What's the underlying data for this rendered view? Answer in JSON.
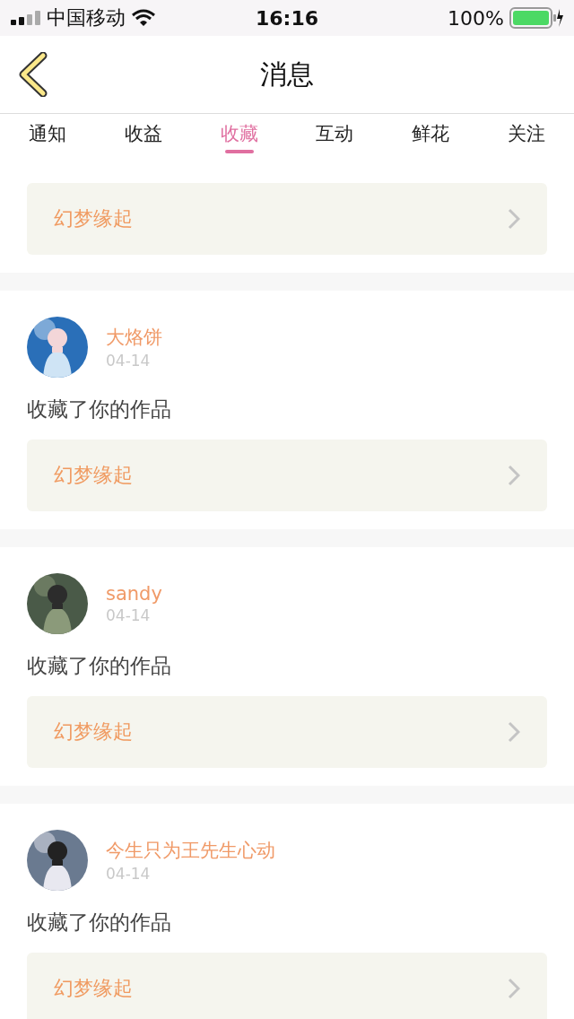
{
  "status_bar": {
    "carrier": "中国移动",
    "time": "16:16",
    "battery": "100%"
  },
  "nav": {
    "title": "消息"
  },
  "tabs": [
    {
      "label": "通知",
      "selected": false
    },
    {
      "label": "收益",
      "selected": false
    },
    {
      "label": "收藏",
      "selected": true
    },
    {
      "label": "互动",
      "selected": false
    },
    {
      "label": "鲜花",
      "selected": false
    },
    {
      "label": "关注",
      "selected": false
    }
  ],
  "messages": [
    {
      "kind": "partial",
      "work": "幻梦缘起"
    },
    {
      "kind": "full",
      "user": "大烙饼",
      "date": "04-14",
      "text": "收藏了你的作品",
      "work": "幻梦缘起"
    },
    {
      "kind": "full",
      "user": "sandy",
      "date": "04-14",
      "text": "收藏了你的作品",
      "work": "幻梦缘起"
    },
    {
      "kind": "full",
      "user": "今生只为王先生心动",
      "date": "04-14",
      "text": "收藏了你的作品",
      "work": "幻梦缘起"
    }
  ]
}
